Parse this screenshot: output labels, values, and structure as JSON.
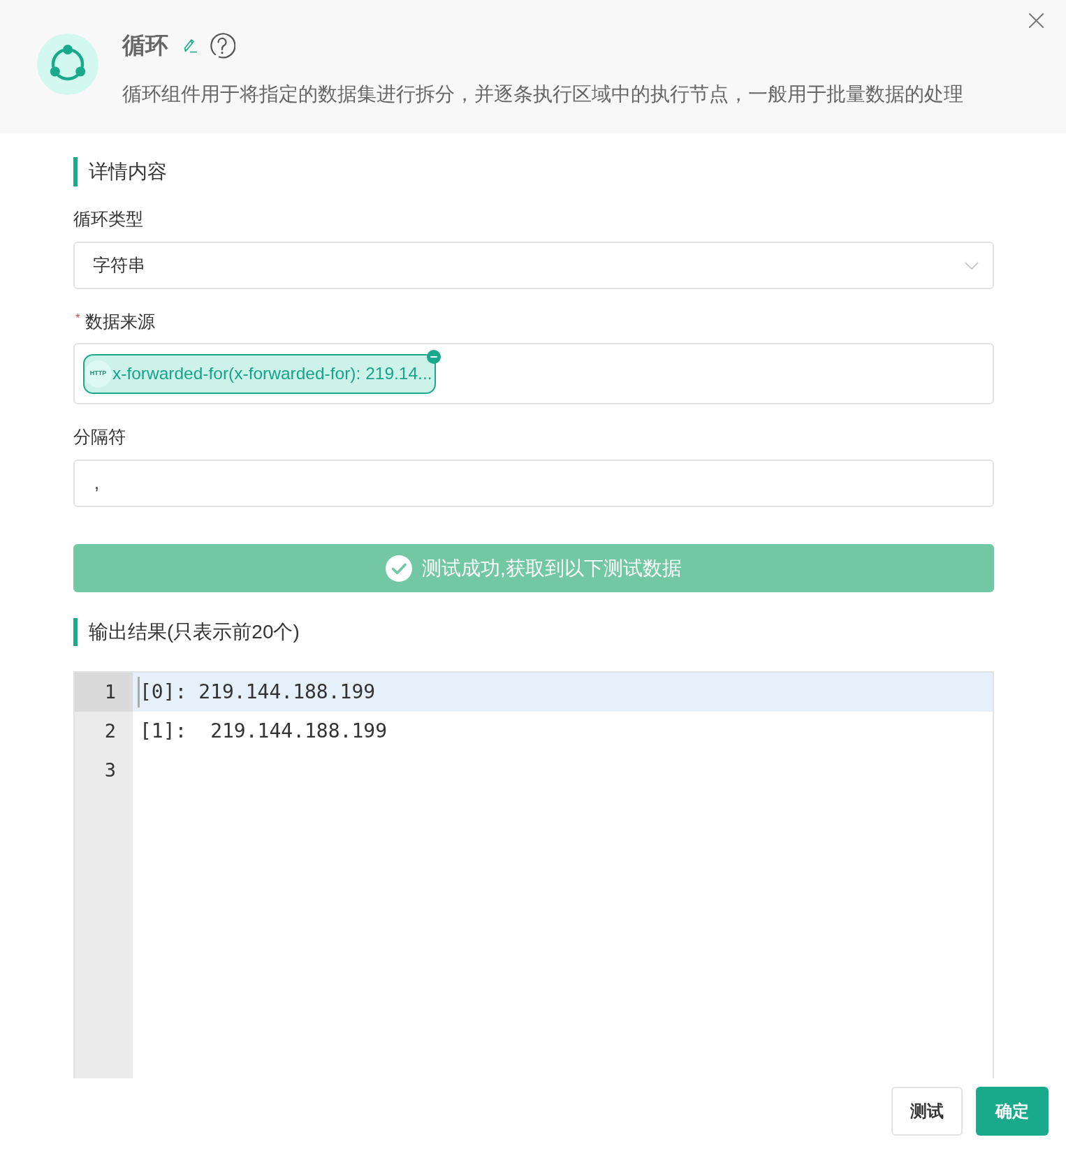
{
  "header": {
    "title": "循环",
    "description": "循环组件用于将指定的数据集进行拆分，并逐条执行区域中的执行节点，一般用于批量数据的处理"
  },
  "details_section": {
    "heading": "详情内容"
  },
  "fields": [
    {
      "kind": "select",
      "label": "循环类型",
      "value": "字符串"
    },
    {
      "kind": "tags",
      "required_mark": "*",
      "label": "数据来源",
      "tags": [
        {
          "badge": "HTTP",
          "text": "x-forwarded-for(x-forwarded-for): 219.14..."
        }
      ]
    },
    {
      "kind": "input",
      "label": "分隔符",
      "value": ","
    }
  ],
  "test_result": {
    "success": true,
    "message": "测试成功,获取到以下测试数据"
  },
  "output_section": {
    "heading": "输出结果(只表示前20个)"
  },
  "editor": {
    "lines": [
      {
        "number": "1",
        "text": "[0]: 219.144.188.199",
        "selected": true
      },
      {
        "number": "2",
        "text": "[1]:  219.144.188.199",
        "selected": false
      },
      {
        "number": "3",
        "selected": false
      }
    ]
  },
  "buttons": [
    {
      "label": "测试",
      "kind": "secondary"
    },
    {
      "label": "确定",
      "kind": "primary"
    }
  ]
}
